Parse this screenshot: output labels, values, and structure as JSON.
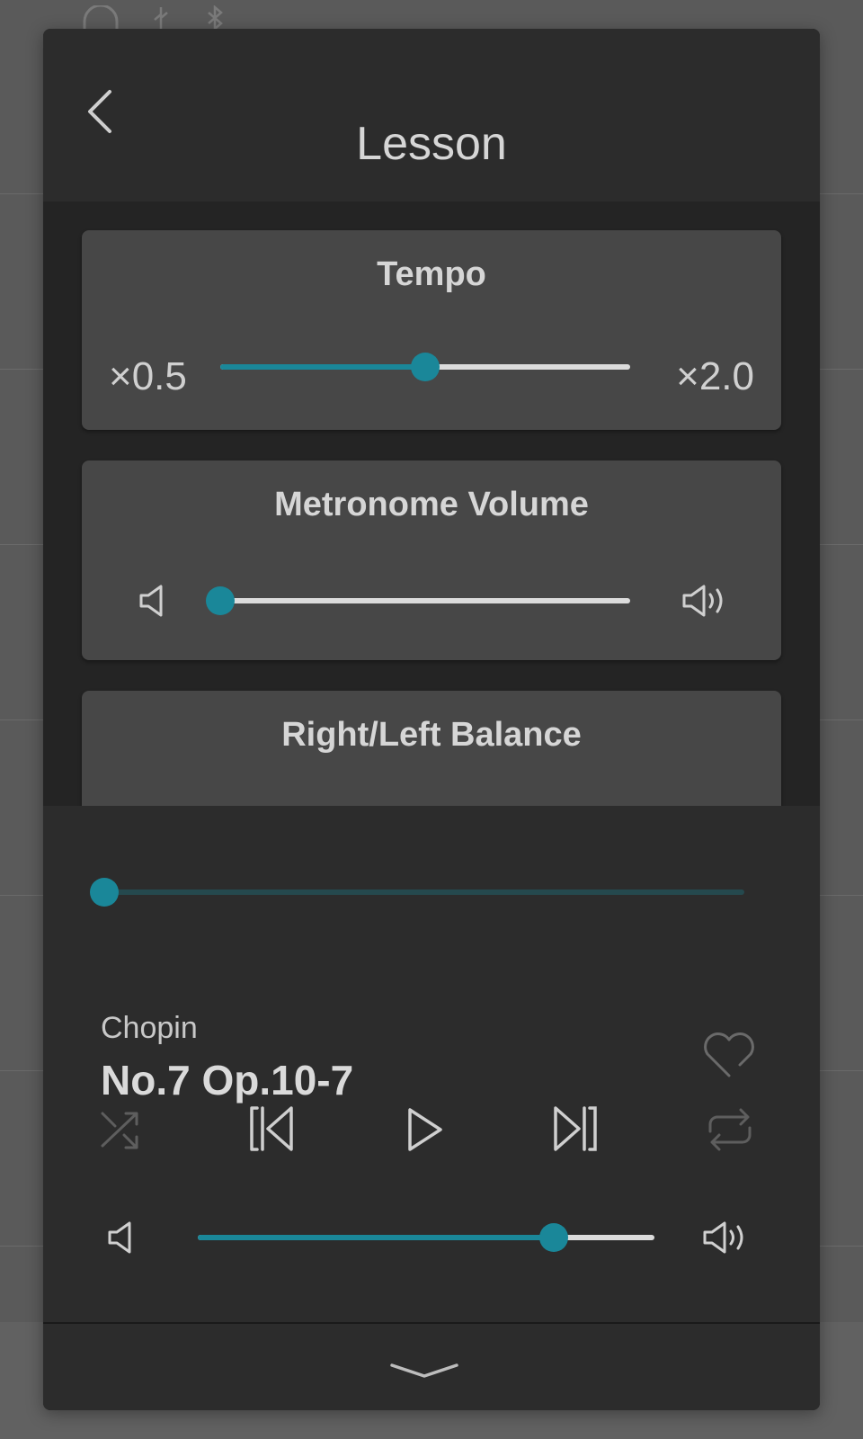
{
  "header": {
    "title": "Lesson"
  },
  "tempo": {
    "title": "Tempo",
    "min_label": "×0.5",
    "max_label": "×2.0",
    "value_fraction": 0.5
  },
  "metronome": {
    "title": "Metronome Volume",
    "value_fraction": 0.0
  },
  "balance": {
    "title": "Right/Left Balance"
  },
  "player": {
    "progress_fraction": 0.0,
    "composer": "Chopin",
    "song_title": "No.7 Op.10-7",
    "volume_fraction": 0.78
  },
  "colors": {
    "accent": "#1a8799",
    "modal_bg": "#242424",
    "card_bg": "#474747",
    "panel_bg": "#2c2c2c"
  },
  "icons": {
    "back": "chevron-left-icon",
    "speaker_low": "speaker-icon",
    "speaker_high": "speaker-loud-icon",
    "favorite": "heart-icon",
    "shuffle": "shuffle-icon",
    "previous": "skip-previous-icon",
    "play": "play-icon",
    "next": "skip-next-icon",
    "repeat": "repeat-icon",
    "collapse": "chevron-down-icon"
  }
}
